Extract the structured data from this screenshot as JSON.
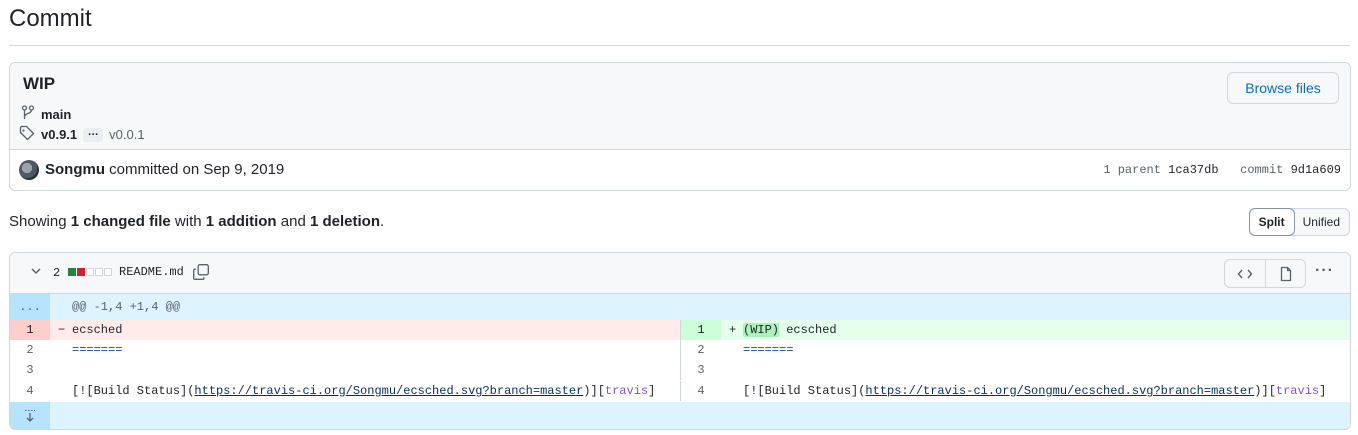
{
  "page": {
    "title": "Commit"
  },
  "commit": {
    "message": "WIP",
    "browse_label": "Browse files",
    "branch": "main",
    "tags": {
      "first": "v0.9.1",
      "ellipsis": "…",
      "last": "v0.0.1"
    },
    "author": "Songmu",
    "committed_text": "committed on Sep 9, 2019",
    "parent_label": "1 parent",
    "parent_sha": "1ca37db",
    "commit_label": "commit",
    "commit_sha": "9d1a609"
  },
  "summary": {
    "prefix": "Showing ",
    "files": "1 changed file",
    "with": " with ",
    "additions": "1 addition",
    "and": " and ",
    "deletions": "1 deletion",
    "end": "."
  },
  "view_toggle": {
    "split": "Split",
    "unified": "Unified",
    "active": "split"
  },
  "file": {
    "change_count": "2",
    "name": "README.md",
    "diffstat": {
      "additions": 1,
      "deletions": 1,
      "neutral": 3
    },
    "hunk_gutter": "...",
    "hunk_header": "@@ -1,4 +1,4 @@",
    "lines": [
      {
        "left_no": "1",
        "left_sign": "−",
        "left_code": "ecsched",
        "right_no": "1",
        "right_sign": "+",
        "right_added": "(WIP)",
        "right_code": " ecsched"
      },
      {
        "left_no": "2",
        "left_code": "=======",
        "right_no": "2",
        "right_code": "======="
      },
      {
        "left_no": "3",
        "left_code": "",
        "right_no": "3",
        "right_code": ""
      },
      {
        "left_no": "4",
        "left_pre": "[![Build Status](",
        "left_url": "https://travis-ci.org/Songmu/ecsched.svg?branch=master",
        "left_mid": ")][",
        "left_ref": "travis",
        "left_end": "]",
        "right_no": "4",
        "right_pre": "[![Build Status](",
        "right_url": "https://travis-ci.org/Songmu/ecsched.svg?branch=master",
        "right_mid": ")][",
        "right_ref": "travis",
        "right_end": "]"
      }
    ]
  },
  "icons": {
    "branch": "git-branch-icon",
    "tag": "tag-icon",
    "chevron": "chevron-down-icon",
    "copy": "copy-icon",
    "code": "code-icon",
    "file": "file-icon",
    "kebab": "kebab-horizontal-icon",
    "expand": "unfold-down-icon"
  },
  "colors": {
    "link": "#0969da",
    "addition": "#1f883d",
    "deletion": "#cf222e",
    "hunk_bg": "#ddf4ff",
    "add_bg": "#e6ffec",
    "del_bg": "#ffebe9"
  }
}
